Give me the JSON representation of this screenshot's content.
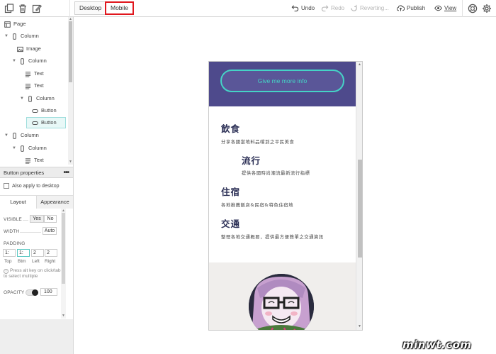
{
  "toolbar": {
    "desktop_label": "Desktop",
    "mobile_label": "Mobile",
    "undo_label": "Undo",
    "redo_label": "Redo",
    "reverting_label": "Reverting...",
    "publish_label": "Publish",
    "view_label": "View",
    "accent_color": "#e0161d"
  },
  "tree": {
    "items": [
      {
        "label": "Page",
        "icon": "page-icon"
      },
      {
        "label": "Column",
        "icon": "column-icon"
      },
      {
        "label": "Image",
        "icon": "image-icon"
      },
      {
        "label": "Column",
        "icon": "column-icon"
      },
      {
        "label": "Text",
        "icon": "text-icon"
      },
      {
        "label": "Text",
        "icon": "text-icon"
      },
      {
        "label": "Column",
        "icon": "column-icon"
      },
      {
        "label": "Button",
        "icon": "button-icon"
      },
      {
        "label": "Button",
        "icon": "button-icon"
      },
      {
        "label": "Column",
        "icon": "column-icon"
      },
      {
        "label": "Column",
        "icon": "column-icon"
      },
      {
        "label": "Text",
        "icon": "text-icon"
      }
    ]
  },
  "props": {
    "title": "Button properties",
    "apply_desktop": "Also apply to desktop",
    "tab_layout": "Layout",
    "tab_appearance": "Appearance",
    "visible_label": "VISIBLE",
    "visible_yes": "Yes",
    "visible_no": "No",
    "width_label": "WIDTH",
    "width_value": "Auto",
    "padding_label": "PADDING",
    "padding": [
      {
        "value": "1:",
        "label": "Top"
      },
      {
        "value": "1:",
        "label": "Btm"
      },
      {
        "value": "2",
        "label": "Left"
      },
      {
        "value": "2",
        "label": "Right"
      }
    ],
    "hint": "Press alt key on click/tab to select multiple",
    "opacity_label": "OPACITY",
    "opacity_value": "100"
  },
  "phone": {
    "cta_label": "Give me more info",
    "hero_color": "#4e4a8c",
    "cta_color": "#45d3c6",
    "sections": [
      {
        "heading": "飲食",
        "body": "分享各國當地料品嚐到之平民美食"
      },
      {
        "heading": "流行",
        "body": "提供各國時尚潮流最新流行指標"
      },
      {
        "heading": "住宿",
        "body": "各地推薦飯店&民宿&特色住宿地"
      },
      {
        "heading": "交通",
        "body": "整理各地交通概要，提供最方便簡單之交通資訊"
      }
    ]
  },
  "watermark": "minwt.com"
}
